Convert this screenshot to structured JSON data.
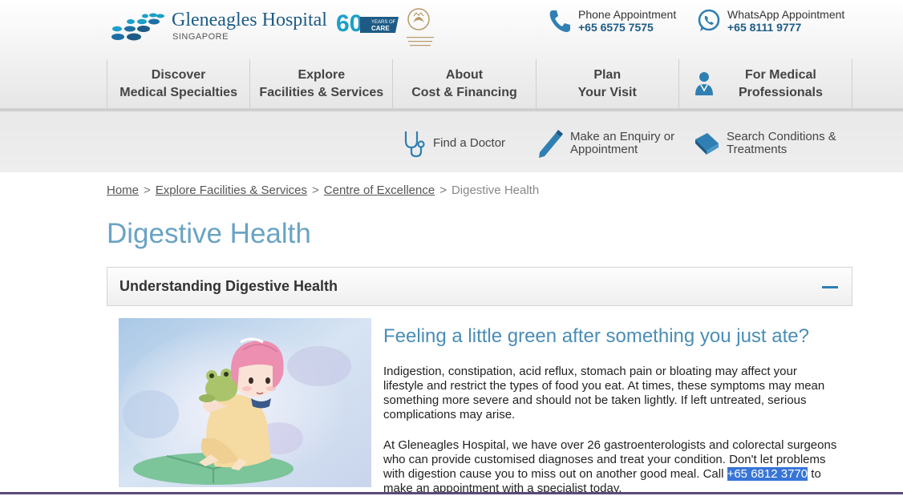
{
  "brand": {
    "name": "Gleneagles Hospital",
    "country": "SINGAPORE",
    "badge_number": "60",
    "badge_line1": "YEARS OF",
    "badge_line2": "CARE"
  },
  "contacts": [
    {
      "label": "Phone Appointment",
      "number": "+65 6575 7575",
      "icon": "phone-icon"
    },
    {
      "label": "WhatsApp Appointment",
      "number": "+65 8111 9777",
      "icon": "whatsapp-icon"
    }
  ],
  "nav": [
    {
      "line1": "Discover",
      "line2": "Medical Specialties"
    },
    {
      "line1": "Explore",
      "line2": "Facilities & Services"
    },
    {
      "line1": "About",
      "line2": "Cost & Financing"
    },
    {
      "line1": "Plan",
      "line2": "Your Visit"
    },
    {
      "line1": "For Medical",
      "line2": "Professionals",
      "icon": "doctor-icon"
    }
  ],
  "quick_links": [
    {
      "line1": "Find a Doctor",
      "line2": "",
      "icon": "stethoscope-icon"
    },
    {
      "line1": "Make an Enquiry or",
      "line2": "Appointment",
      "icon": "pencil-icon"
    },
    {
      "line1": "Search Conditions &",
      "line2": "Treatments",
      "icon": "book-icon"
    }
  ],
  "breadcrumb": {
    "items": [
      "Home",
      "Explore Facilities & Services",
      "Centre of Excellence"
    ],
    "current": "Digestive Health",
    "separator": ">"
  },
  "page_title": "Digestive Health",
  "accordion": {
    "title": "Understanding Digestive Health",
    "state": "expanded"
  },
  "content": {
    "subtitle": "Feeling a little green after something you just ate?",
    "para1": "Indigestion, constipation, acid reflux, stomach pain or bloating may affect your lifestyle and restrict the types of food you eat. At times, these symptoms may mean something more severe and should not be taken lightly. If left untreated, serious complications may arise.",
    "para2_before": "At Gleneagles Hospital, we have over 26 gastroenterologists and colorectal surgeons who can provide customised diagnoses and treat your condition. Don't let problems with digestion cause you to miss out on another good meal. Call ",
    "para2_link": "+65 6812 3770",
    "para2_after": " to make an appointment with a specialist today."
  },
  "colors": {
    "brand_blue": "#1d5b86",
    "title_blue": "#6aa3c4",
    "subtitle_blue": "#4a8db5",
    "selection": "#3875d7",
    "accent_toggle": "#2f7fb3"
  }
}
